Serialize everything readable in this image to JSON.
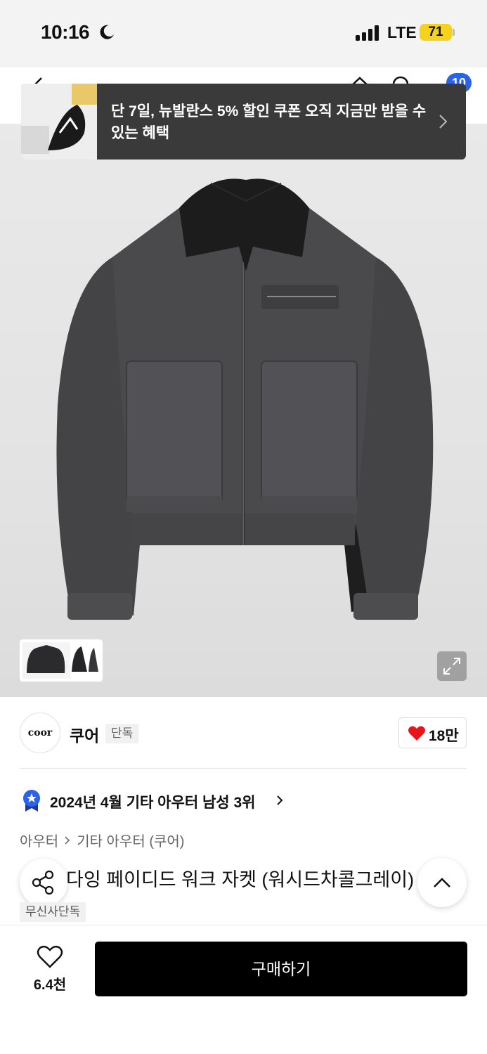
{
  "status_bar": {
    "time": "10:16",
    "network": "LTE",
    "battery": "71"
  },
  "header": {
    "cart_count": "10"
  },
  "promo_banner": {
    "text": "단 7일, 뉴발란스 5% 할인 쿠폰 오직 지금만 받을 수 있는 혜택"
  },
  "brand": {
    "logo_text": "coor",
    "name": "쿠어",
    "tag": "단독",
    "like_count": "18만"
  },
  "ranking": {
    "text": "2024년 4월 기타 아우터 남성 3위"
  },
  "breadcrumb": {
    "level1": "아우터",
    "level2": "기타 아우터 (쿠어)"
  },
  "product": {
    "title": "다잉 페이디드 워크 자켓 (워시드차콜그레이)",
    "exclusive_tag": "무신사단독"
  },
  "bottom_bar": {
    "wish_count": "6.4천",
    "buy_label": "구매하기"
  },
  "colors": {
    "accent_blue": "#2a62ea",
    "battery_yellow": "#f5d21b",
    "heart_red": "#e8141b",
    "buy_black": "#000000"
  }
}
